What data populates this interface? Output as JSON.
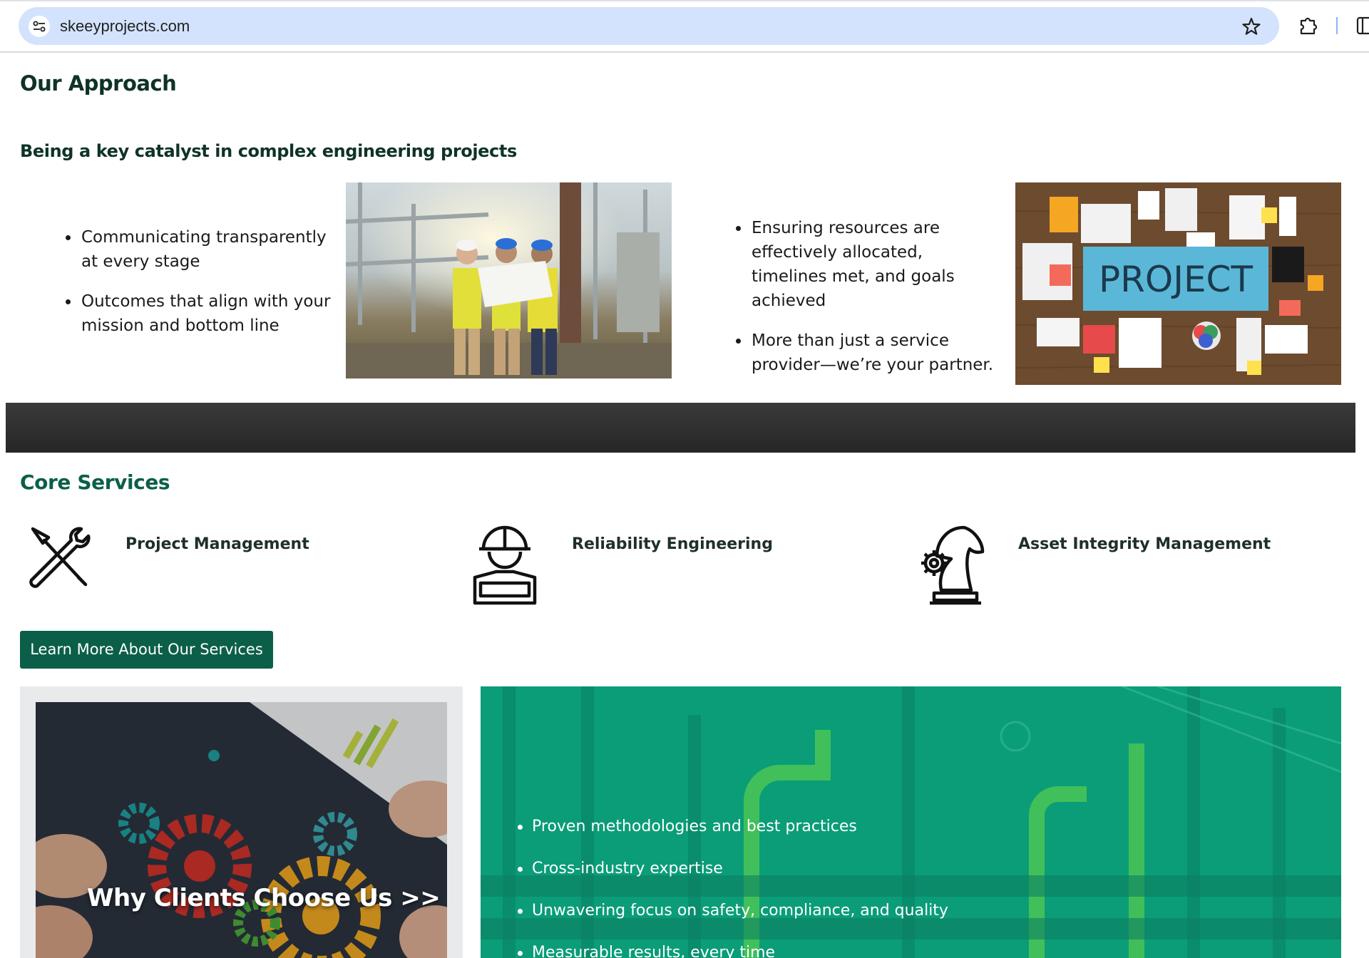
{
  "browser": {
    "url": "skeeyprojects.com"
  },
  "approach": {
    "title": "Our Approach",
    "subtitle": "Being a key catalyst in complex engineering projects",
    "left_bullets": [
      "Communicating transparently at every stage",
      "Outcomes that align with your mission and bottom line"
    ],
    "right_bullets": [
      "Ensuring resources are effectively allocated, timelines met, and goals achieved",
      "More than just a service provider—we’re your partner."
    ],
    "project_board_word": "PROJECT"
  },
  "core_services": {
    "title": "Core Services",
    "items": [
      {
        "label": "Project Management",
        "icon": "tools-icon"
      },
      {
        "label": "Reliability Engineering",
        "icon": "engineer-icon"
      },
      {
        "label": "Asset Integrity Management",
        "icon": "chess-knight-gear-icon"
      }
    ],
    "button_label": "Learn More About Our Services"
  },
  "why": {
    "title": "Why Clients Choose Us >>",
    "bullets": [
      "Proven methodologies and best practices",
      "Cross-industry expertise",
      "Unwavering focus on safety, compliance, and quality",
      "Measurable results, every time"
    ]
  },
  "colors": {
    "brand_green": "#0b5f48",
    "heading_dark": "#0f3325",
    "panel_green": "#0a9a76",
    "omnibox": "#d3e3fd"
  }
}
